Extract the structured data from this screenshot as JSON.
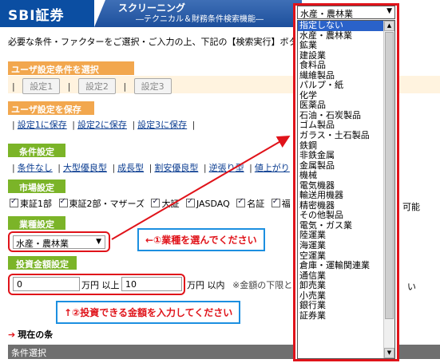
{
  "header": {
    "logo": "SBI証券",
    "title": "スクリーニング",
    "subtitle": "―テクニカル＆財務条件検索機能―"
  },
  "intro": "必要な条件・ファクターをご選択・ご入力の上、下記の【検索実行】ボタン",
  "user_select": {
    "header": "ユーザ設定条件を選択",
    "buttons": [
      "設定1",
      "設定2",
      "設定3"
    ]
  },
  "user_save": {
    "header": "ユーザ設定を保存",
    "links": [
      "設定1に保存",
      "設定2に保存",
      "設定3に保存"
    ]
  },
  "condition": {
    "header": "条件設定",
    "links": [
      "条件なし",
      "大型優良型",
      "成長型",
      "割安優良型",
      "逆張り型",
      "値上がり"
    ]
  },
  "market": {
    "header": "市場設定",
    "items": [
      "東証1部",
      "東証2部・マザーズ",
      "大証",
      "JASDAQ",
      "名証",
      "福"
    ],
    "trailing": "可能"
  },
  "industry": {
    "header": "業種設定",
    "selected": "水産・農林業"
  },
  "amount": {
    "header": "投資金額設定",
    "min_value": "0",
    "unit_min": "万円 以上",
    "max_value": "10",
    "unit_max": "万円 以内",
    "note": "※金額の下限と",
    "note_tail": "い"
  },
  "annotations": {
    "note1": "←①業種を選んでください",
    "note2": "↑②投資できる金額を入力してください"
  },
  "current": {
    "title": "現在の条",
    "bar_label": "条件選択"
  },
  "dropdown": {
    "selected": "水産・農林業",
    "items": [
      "指定しない",
      "水産・農林業",
      "鉱業",
      "建設業",
      "食料品",
      "繊維製品",
      "パルプ・紙",
      "化学",
      "医薬品",
      "石油・石炭製品",
      "ゴム製品",
      "ガラス・土石製品",
      "鉄鋼",
      "非鉄金属",
      "金属製品",
      "機械",
      "電気機器",
      "輸送用機器",
      "精密機器",
      "その他製品",
      "電気・ガス業",
      "陸運業",
      "海運業",
      "空運業",
      "倉庫・運輸関連業",
      "通信業",
      "卸売業",
      "小売業",
      "銀行業",
      "証券業"
    ],
    "highlight_index": 0
  },
  "colors": {
    "brand_blue": "#0b4ea2",
    "orange": "#f2a74e",
    "green": "#7bb428",
    "red_outline": "#e0131a",
    "blue_outline": "#1c8fe0",
    "highlight": "#2a62c9"
  }
}
